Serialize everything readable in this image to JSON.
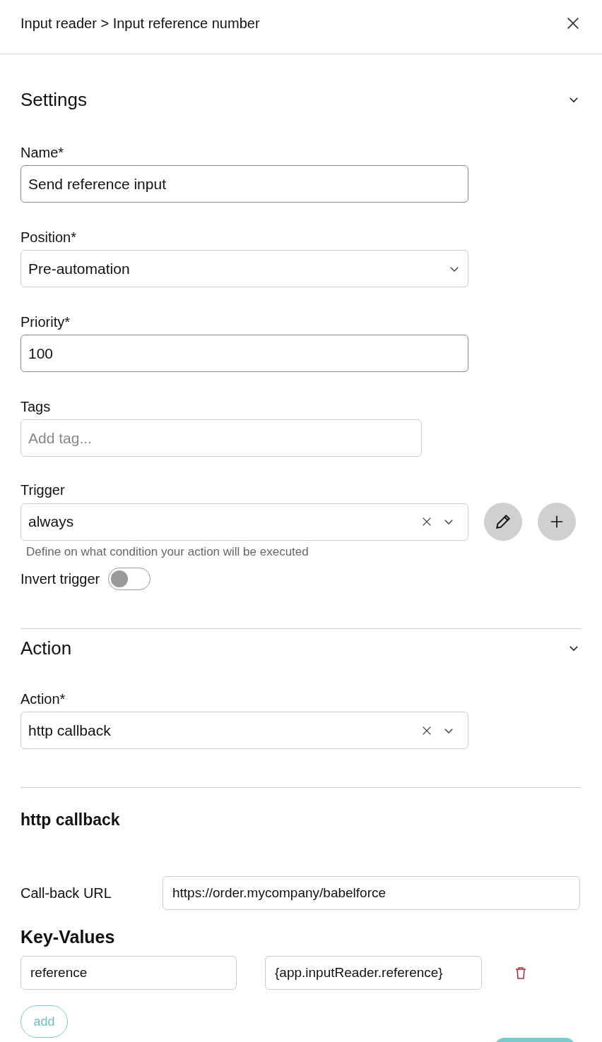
{
  "header": {
    "breadcrumb": "Input reader > Input reference number"
  },
  "settings": {
    "title": "Settings",
    "expanded": true,
    "fields": [
      {
        "kind": "text",
        "label": "Name*",
        "value": "Send reference input"
      },
      {
        "kind": "select",
        "label": "Position*",
        "value": "Pre-automation"
      },
      {
        "kind": "text",
        "label": "Priority*",
        "value": "100"
      },
      {
        "kind": "tags",
        "label": "Tags",
        "placeholder": "Add tag..."
      }
    ],
    "trigger": {
      "label": "Trigger",
      "value": "always",
      "hint": "Define on what condition your action will be executed"
    },
    "invert": {
      "label": "Invert trigger",
      "on": false
    }
  },
  "action": {
    "title": "Action",
    "expanded": true,
    "label": "Action*",
    "value": "http callback"
  },
  "callback": {
    "title": "http callback",
    "url_label": "Call-back URL",
    "url_value": "https://order.mycompany/babelforce",
    "key_values_title": "Key-Values",
    "pairs": [
      {
        "key": "reference",
        "value": "{app.inputReader.reference}"
      }
    ],
    "add_label": "add"
  }
}
